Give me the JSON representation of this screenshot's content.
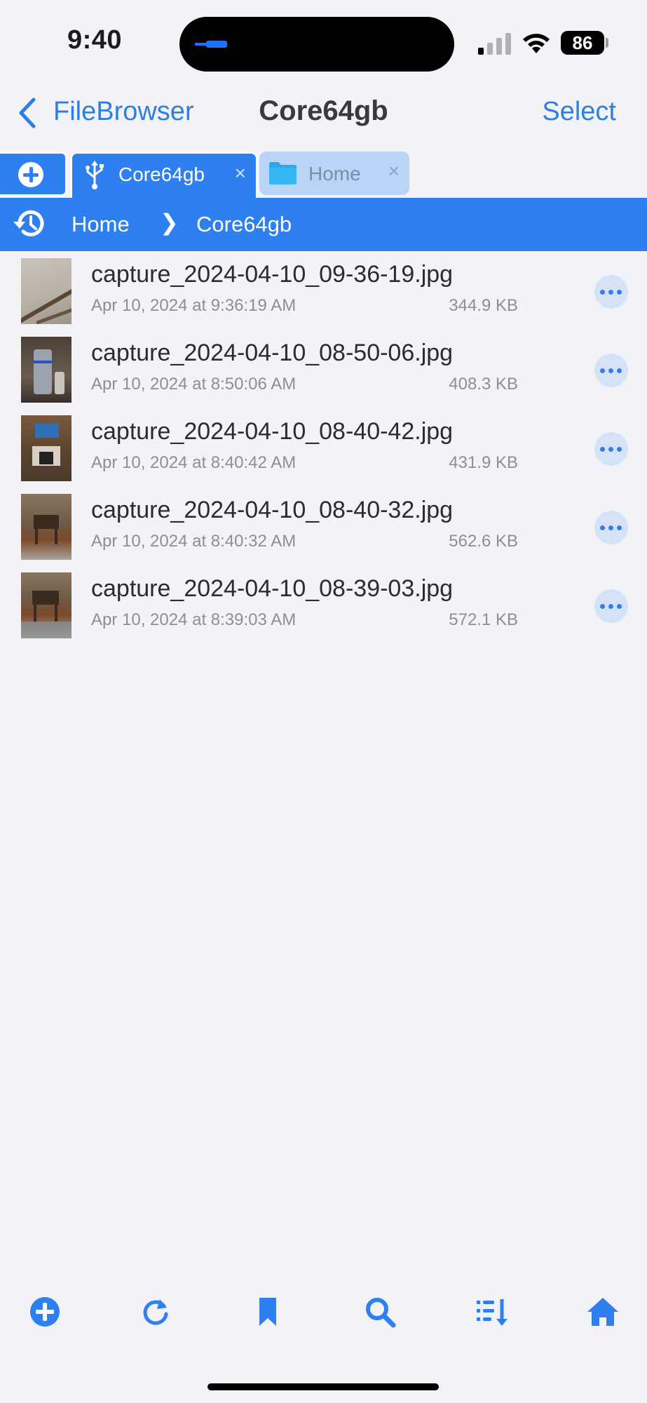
{
  "status_bar": {
    "time": "9:40",
    "battery": "86"
  },
  "nav": {
    "back_label": "FileBrowser",
    "title": "Core64gb",
    "select_label": "Select"
  },
  "tabs": [
    {
      "label": "Core64gb",
      "close": "×",
      "icon": "usb-icon",
      "active": true
    },
    {
      "label": "Home",
      "close": "×",
      "icon": "folder-icon",
      "active": false
    }
  ],
  "breadcrumb": {
    "items": [
      "Home",
      "Core64gb"
    ],
    "separator": "❯"
  },
  "files": [
    {
      "name": "capture_2024-04-10_09-36-19.jpg",
      "date": "Apr 10, 2024 at 9:36:19 AM",
      "size": "344.9 KB"
    },
    {
      "name": "capture_2024-04-10_08-50-06.jpg",
      "date": "Apr 10, 2024 at 8:50:06 AM",
      "size": "408.3 KB"
    },
    {
      "name": "capture_2024-04-10_08-40-42.jpg",
      "date": "Apr 10, 2024 at 8:40:42 AM",
      "size": "431.9 KB"
    },
    {
      "name": "capture_2024-04-10_08-40-32.jpg",
      "date": "Apr 10, 2024 at 8:40:32 AM",
      "size": "562.6 KB"
    },
    {
      "name": "capture_2024-04-10_08-39-03.jpg",
      "date": "Apr 10, 2024 at 8:39:03 AM",
      "size": "572.1 KB"
    }
  ],
  "toolbar": [
    "add-icon",
    "refresh-icon",
    "bookmark-icon",
    "search-icon",
    "sort-icon",
    "home-icon"
  ],
  "colors": {
    "accent": "#2e7ff0",
    "background": "#f2f2f7",
    "secondary_text": "#8e8e93"
  }
}
